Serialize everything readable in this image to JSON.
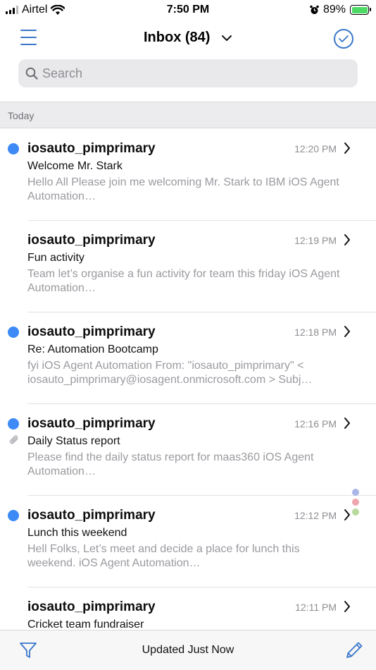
{
  "status_bar": {
    "carrier": "Airtel",
    "time": "7:50 PM",
    "battery_percent": "89%"
  },
  "nav": {
    "title": "Inbox (84)",
    "menu_icon": "hamburger-menu-icon",
    "select_icon": "checkmark-circle-icon"
  },
  "search": {
    "placeholder": "Search"
  },
  "section": {
    "label": "Today"
  },
  "emails": [
    {
      "sender": "iosauto_pimprimary",
      "time": "12:20 PM",
      "subject": "Welcome Mr. Stark",
      "preview": "Hello All Please join me welcoming Mr. Stark to IBM iOS Agent Automation…",
      "unread": true,
      "attachment": false
    },
    {
      "sender": "iosauto_pimprimary",
      "time": "12:19 PM",
      "subject": "Fun activity",
      "preview": "Team let’s organise a fun activity for team this friday iOS Agent Automation…",
      "unread": false,
      "attachment": false
    },
    {
      "sender": "iosauto_pimprimary",
      "time": "12:18 PM",
      "subject": "Re: Automation Bootcamp",
      "preview": "fyi iOS Agent Automation From: \"iosauto_pimprimary\" < iosauto_pimprimary@iosagent.onmicrosoft.com > Subj…",
      "unread": true,
      "attachment": false
    },
    {
      "sender": "iosauto_pimprimary",
      "time": "12:16 PM",
      "subject": "Daily Status report",
      "preview": "Please find the daily status report for maas360 iOS Agent Automation…",
      "unread": true,
      "attachment": true
    },
    {
      "sender": "iosauto_pimprimary",
      "time": "12:12 PM",
      "subject": "Lunch this weekend",
      "preview": "Hell Folks, Let’s meet and decide a place for lunch this weekend. iOS Agent Automation…",
      "unread": true,
      "attachment": false
    },
    {
      "sender": "iosauto_pimprimary",
      "time": "12:11 PM",
      "subject": "Cricket team fundraiser",
      "preview": "",
      "unread": false,
      "attachment": false
    }
  ],
  "bottom_bar": {
    "status": "Updated Just Now",
    "filter_icon": "filter-funnel-icon",
    "compose_icon": "compose-pencil-icon"
  },
  "colors": {
    "accent": "#3a76c9",
    "unread_dot": "#3d8af7",
    "battery_fill": "#4cd964",
    "scroll_dots": [
      "#a9b6e6",
      "#efa6ac",
      "#b9da9c"
    ]
  }
}
